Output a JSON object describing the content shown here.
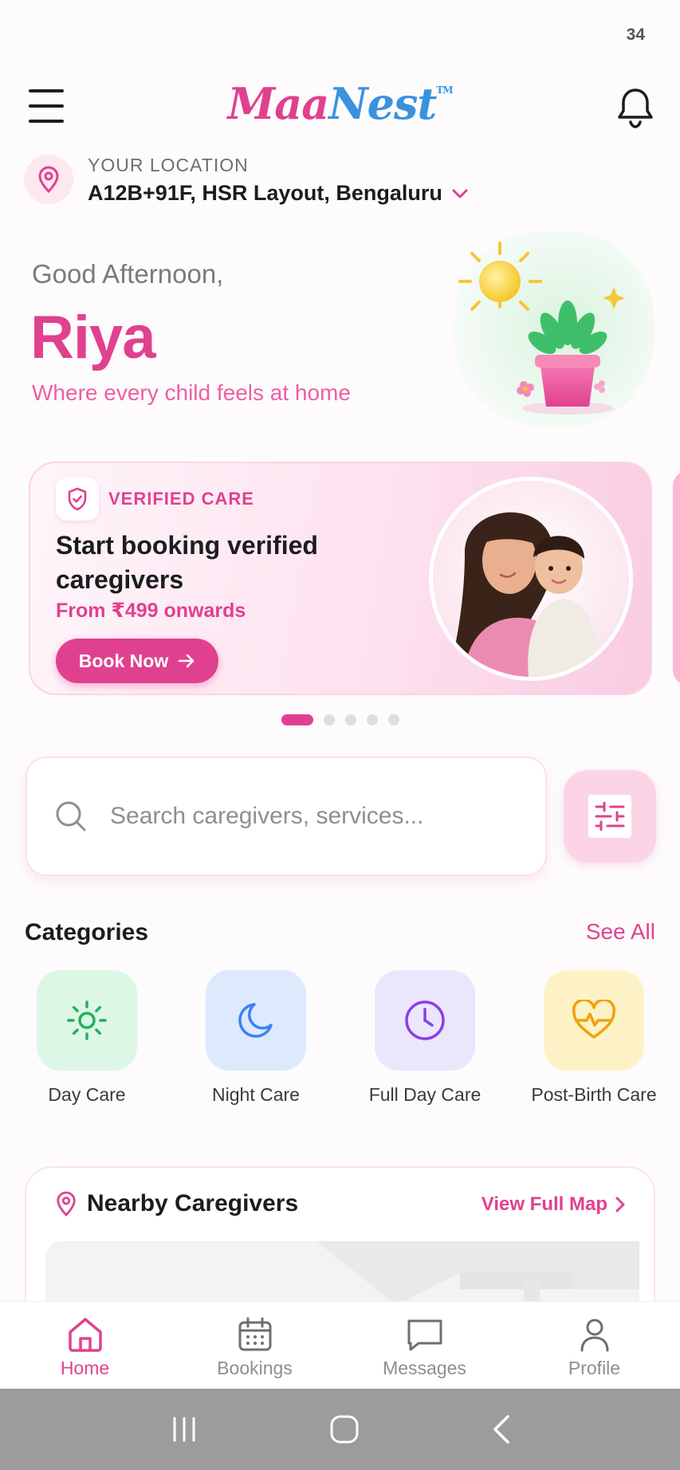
{
  "status": {
    "text": "34"
  },
  "header": {
    "logo_part1": "Maa",
    "logo_part2": "Nest",
    "logo_tm": "TM"
  },
  "location": {
    "label": "YOUR LOCATION",
    "value": "A12B+91F, HSR Layout, Bengaluru"
  },
  "greeting": {
    "salutation": "Good Afternoon,",
    "name": "Riya",
    "tagline": "Where every child feels at home"
  },
  "banner": {
    "badge": "VERIFIED CARE",
    "title": "Start booking verified caregivers",
    "price": "From ₹499 onwards",
    "cta": "Book Now",
    "slide_count": 5,
    "active_slide": 1
  },
  "search": {
    "placeholder": "Search caregivers, services..."
  },
  "categories": {
    "title": "Categories",
    "see_all": "See All",
    "items": [
      {
        "label": "Day Care",
        "icon": "sun-icon",
        "bg": "#dcf7e6",
        "color": "#22b15a"
      },
      {
        "label": "Night Care",
        "icon": "moon-icon",
        "bg": "#dde9fd",
        "color": "#3b82f6"
      },
      {
        "label": "Full Day Care",
        "icon": "clock-icon",
        "bg": "#ece6fd",
        "color": "#8b3fe6"
      },
      {
        "label": "Post-Birth Care",
        "icon": "heart-pulse-icon",
        "bg": "#fdf2c6",
        "color": "#f0a20c"
      }
    ]
  },
  "nearby": {
    "title": "Nearby Caregivers",
    "link": "View Full Map"
  },
  "bottom_nav": {
    "items": [
      {
        "label": "Home",
        "icon": "home-icon",
        "active": true
      },
      {
        "label": "Bookings",
        "icon": "calendar-icon",
        "active": false
      },
      {
        "label": "Messages",
        "icon": "message-icon",
        "active": false
      },
      {
        "label": "Profile",
        "icon": "user-icon",
        "active": false
      }
    ]
  },
  "colors": {
    "accent": "#e0418f",
    "brand_blue": "#3a92df"
  }
}
